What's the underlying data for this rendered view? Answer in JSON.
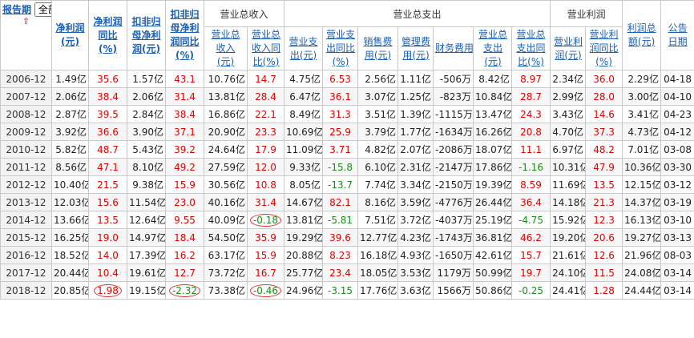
{
  "header": {
    "report_period": "报告期",
    "period_select": "全部",
    "sort_arrow": "⇧",
    "net_profit": "净利润(元)",
    "net_profit_yoy": "净利润同比(%)",
    "deducted_net_profit": "扣非归母净利润(元)",
    "deducted_yoy": "扣非归母净利润同比(%)",
    "revenue_group": "营业总收入",
    "revenue": "营业总收入(元)",
    "revenue_yoy": "营业总收入同比(%)",
    "expense_group": "营业总支出",
    "expense": "营业支出(元)",
    "expense_yoy": "营业支出同比(%)",
    "selling_exp": "销售费用(元)",
    "admin_exp": "管理费用(元)",
    "finance_exp": "财务费用",
    "total_exp": "营业总支出(元)",
    "total_exp_yoy": "营业总支出同比(%)",
    "op_profit_group": "营业利润",
    "op_profit": "营业利润(元)",
    "op_profit_yoy": "营业利润同比(%)",
    "total_profit": "利润总额(元)",
    "announce_date": "公告日期"
  },
  "rows": [
    {
      "period": "2006-12",
      "np": "1.49亿",
      "npy": "35.6",
      "dnp": "1.57亿",
      "dnpy": "43.1",
      "rev": "10.76亿",
      "revy": "14.7",
      "exp": "4.75亿",
      "expy": "6.53",
      "sell": "2.56亿",
      "adm": "1.11亿",
      "fin": "-506万",
      "texp": "8.42亿",
      "texpy": "8.97",
      "op": "2.34亿",
      "opy": "36.0",
      "tp": "2.29亿",
      "date": "04-18"
    },
    {
      "period": "2007-12",
      "np": "2.06亿",
      "npy": "38.4",
      "dnp": "2.06亿",
      "dnpy": "31.4",
      "rev": "13.81亿",
      "revy": "28.4",
      "exp": "6.47亿",
      "expy": "36.1",
      "sell": "3.07亿",
      "adm": "1.25亿",
      "fin": "-823万",
      "texp": "10.84亿",
      "texpy": "28.7",
      "op": "2.99亿",
      "opy": "28.0",
      "tp": "3.00亿",
      "date": "04-10"
    },
    {
      "period": "2008-12",
      "np": "2.87亿",
      "npy": "39.5",
      "dnp": "2.84亿",
      "dnpy": "38.4",
      "rev": "16.86亿",
      "revy": "22.1",
      "exp": "8.49亿",
      "expy": "31.3",
      "sell": "3.51亿",
      "adm": "1.39亿",
      "fin": "-1115万",
      "texp": "13.47亿",
      "texpy": "24.3",
      "op": "3.43亿",
      "opy": "14.6",
      "tp": "3.41亿",
      "date": "04-23"
    },
    {
      "period": "2009-12",
      "np": "3.92亿",
      "npy": "36.6",
      "dnp": "3.90亿",
      "dnpy": "37.1",
      "rev": "20.90亿",
      "revy": "23.3",
      "exp": "10.69亿",
      "expy": "25.9",
      "sell": "3.79亿",
      "adm": "1.77亿",
      "fin": "-1634万",
      "texp": "16.26亿",
      "texpy": "20.8",
      "op": "4.70亿",
      "opy": "37.3",
      "tp": "4.73亿",
      "date": "04-12"
    },
    {
      "period": "2010-12",
      "np": "5.82亿",
      "npy": "48.7",
      "dnp": "5.43亿",
      "dnpy": "39.2",
      "rev": "24.64亿",
      "revy": "17.9",
      "exp": "11.09亿",
      "expy": "3.71",
      "sell": "4.82亿",
      "adm": "2.07亿",
      "fin": "-2086万",
      "texp": "18.07亿",
      "texpy": "11.1",
      "op": "6.97亿",
      "opy": "48.2",
      "tp": "7.01亿",
      "date": "03-08"
    },
    {
      "period": "2011-12",
      "np": "8.56亿",
      "npy": "47.1",
      "dnp": "8.10亿",
      "dnpy": "49.2",
      "rev": "27.59亿",
      "revy": "12.0",
      "exp": "9.33亿",
      "expy": "-15.8",
      "sell": "6.10亿",
      "adm": "2.31亿",
      "fin": "-2147万",
      "texp": "17.86亿",
      "texpy": "-1.16",
      "op": "10.31亿",
      "opy": "47.9",
      "tp": "10.36亿",
      "date": "03-30"
    },
    {
      "period": "2012-12",
      "np": "10.40亿",
      "npy": "21.5",
      "dnp": "9.38亿",
      "dnpy": "15.9",
      "rev": "30.56亿",
      "revy": "10.8",
      "exp": "8.05亿",
      "expy": "-13.7",
      "sell": "7.74亿",
      "adm": "3.34亿",
      "fin": "-2150万",
      "texp": "19.39亿",
      "texpy": "8.59",
      "op": "11.69亿",
      "opy": "13.5",
      "tp": "12.15亿",
      "date": "03-12"
    },
    {
      "period": "2013-12",
      "np": "12.03亿",
      "npy": "15.6",
      "dnp": "11.54亿",
      "dnpy": "23.0",
      "rev": "40.16亿",
      "revy": "31.4",
      "exp": "14.67亿",
      "expy": "82.1",
      "sell": "8.16亿",
      "adm": "3.59亿",
      "fin": "-4776万",
      "texp": "26.44亿",
      "texpy": "36.4",
      "op": "14.18亿",
      "opy": "21.3",
      "tp": "14.37亿",
      "date": "03-19"
    },
    {
      "period": "2014-12",
      "np": "13.66亿",
      "npy": "13.5",
      "dnp": "12.64亿",
      "dnpy": "9.55",
      "rev": "40.09亿",
      "revy": "-0.18",
      "exp": "13.81亿",
      "expy": "-5.81",
      "sell": "7.51亿",
      "adm": "3.72亿",
      "fin": "-4037万",
      "texp": "25.19亿",
      "texpy": "-4.75",
      "op": "15.92亿",
      "opy": "12.3",
      "tp": "16.13亿",
      "date": "03-10"
    },
    {
      "period": "2015-12",
      "np": "16.25亿",
      "npy": "19.0",
      "dnp": "14.97亿",
      "dnpy": "18.4",
      "rev": "54.50亿",
      "revy": "35.9",
      "exp": "19.29亿",
      "expy": "39.6",
      "sell": "12.77亿",
      "adm": "4.23亿",
      "fin": "-1743万",
      "texp": "36.81亿",
      "texpy": "46.2",
      "op": "19.20亿",
      "opy": "20.6",
      "tp": "19.27亿",
      "date": "03-13"
    },
    {
      "period": "2016-12",
      "np": "18.52亿",
      "npy": "14.0",
      "dnp": "17.39亿",
      "dnpy": "16.2",
      "rev": "63.17亿",
      "revy": "15.9",
      "exp": "20.88亿",
      "expy": "8.23",
      "sell": "16.18亿",
      "adm": "4.93亿",
      "fin": "-1650万",
      "texp": "42.61亿",
      "texpy": "15.7",
      "op": "21.61亿",
      "opy": "12.6",
      "tp": "21.96亿",
      "date": "08-03"
    },
    {
      "period": "2017-12",
      "np": "20.44亿",
      "npy": "10.4",
      "dnp": "19.61亿",
      "dnpy": "12.7",
      "rev": "73.72亿",
      "revy": "16.7",
      "exp": "25.77亿",
      "expy": "23.4",
      "sell": "18.05亿",
      "adm": "3.53亿",
      "fin": "1179万",
      "texp": "50.99亿",
      "texpy": "19.7",
      "op": "24.10亿",
      "opy": "11.5",
      "tp": "24.08亿",
      "date": "03-14"
    },
    {
      "period": "2018-12",
      "np": "20.85亿",
      "npy": "1.98",
      "dnp": "19.15亿",
      "dnpy": "-2.32",
      "rev": "73.38亿",
      "revy": "-0.46",
      "exp": "24.96亿",
      "expy": "-3.15",
      "sell": "17.76亿",
      "adm": "3.63亿",
      "fin": "1566万",
      "texp": "50.86亿",
      "texpy": "-0.25",
      "op": "24.41亿",
      "opy": "1.28",
      "tp": "24.44亿",
      "date": "03-14"
    }
  ],
  "colors": {
    "positive": "#e00000",
    "negative": "#1b8a1b",
    "link": "#1a5fb4",
    "annotation": "#e03030"
  }
}
